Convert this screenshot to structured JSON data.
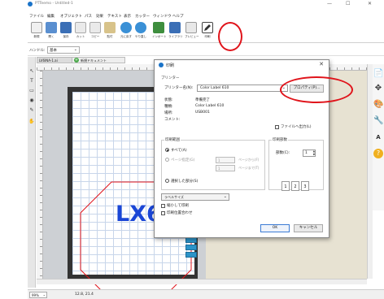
{
  "window": {
    "title": "PTTeemo - Untitled-1",
    "min": "—",
    "max": "☐",
    "close": "✕"
  },
  "menu": [
    "ファイル",
    "編集",
    "オブジェクト",
    "パス",
    "効果",
    "テキスト",
    "表示",
    "カッター",
    "ウィンドウ",
    "ヘルプ"
  ],
  "toolbar": [
    {
      "label": "新規",
      "icon": "new-file-icon",
      "color": "#f0f0f0"
    },
    {
      "label": "開く",
      "icon": "open-folder-icon",
      "color": "#5a8fd0"
    },
    {
      "label": "保存",
      "icon": "save-icon",
      "color": "#3b6fb6"
    },
    {
      "label": "カット",
      "icon": "cut-icon",
      "color": "#eaeaea"
    },
    {
      "label": "コピー",
      "icon": "copy-icon",
      "color": "#eaeaea"
    },
    {
      "label": "貼付",
      "icon": "paste-icon",
      "color": "#d8c38a"
    },
    {
      "label": "元に戻す",
      "icon": "undo-icon",
      "color": "#3a90d6"
    },
    {
      "label": "やり直し",
      "icon": "redo-icon",
      "color": "#3a90d6"
    },
    {
      "label": "インポート",
      "icon": "import-icon",
      "color": "#3e8e3e"
    },
    {
      "label": "ライブラリ",
      "icon": "library-icon",
      "color": "#3b6fb6"
    },
    {
      "label": "プレビュー",
      "icon": "preview-icon",
      "color": "#e8e8e8"
    },
    {
      "label": "印刷",
      "icon": "print-pencil-icon",
      "color": "#444444"
    }
  ],
  "handle": {
    "label": "ハンドル:",
    "value": "基本"
  },
  "tabs": {
    "doc": "LV6INA-1.ai",
    "new_doc": "新規ドキュメント"
  },
  "canvas": {
    "big_text": "LX6"
  },
  "left_tools": [
    "↖",
    "T",
    "▭",
    "◉",
    "✎",
    "✋"
  ],
  "right_tools": [
    "📄",
    "✥",
    "🎨",
    "🔧",
    "A",
    "?"
  ],
  "status": {
    "zoom": "99%",
    "coord": "12.8, 21.4"
  },
  "dialog": {
    "title": "印刷",
    "close": "✕",
    "printer_section": "プリンター",
    "printer_name_label": "プリンター名(N):",
    "printer_name": "Color Label 610",
    "properties_button": "プロパティ(P)...",
    "status_label": "状態:",
    "status_value": "準備完了",
    "type_label": "種類:",
    "type_value": "Color Label 610",
    "where_label": "場所:",
    "where_value": "USB001",
    "comment_label": "コメント:",
    "print_to_file": "ファイルへ出力(L)",
    "range_section": "印刷範囲",
    "range_all": "すべて(A)",
    "range_pages": "ページ指定(G)",
    "page_from": "1",
    "page_from_unit": "ページから(F)",
    "page_to": "1",
    "page_to_unit": "ページまで(T)",
    "range_selection": "選択した部分(S)",
    "copies_section": "印刷部数",
    "copies_label": "部数(C):",
    "copies_value": "1",
    "collate": [
      "1",
      "2",
      "3"
    ],
    "fit_option": "ラベルサイズ",
    "option_shrink": "縮小して印刷",
    "option_tile": "印刷位置合わせ",
    "ok_button": "OK",
    "cancel_button": "キャンセル"
  },
  "annotations": {
    "circle_color": "#e0141b"
  }
}
